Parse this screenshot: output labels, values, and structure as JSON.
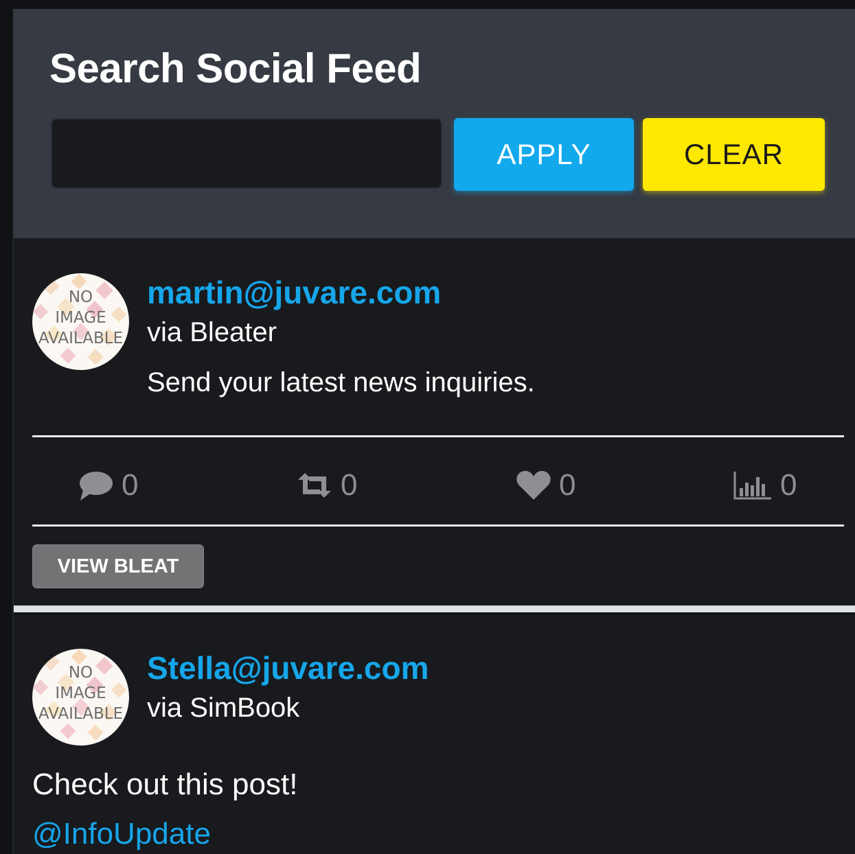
{
  "search": {
    "title": "Search Social Feed",
    "input_value": "",
    "input_placeholder": "",
    "apply_label": "APPLY",
    "clear_label": "CLEAR"
  },
  "colors": {
    "accent_blue": "#16a6ea",
    "apply_button": "#12a8ec",
    "clear_button": "#ffe800",
    "header_bg": "#363a42",
    "panel_bg": "#181a1d"
  },
  "avatar": {
    "line1": "NO",
    "line2": "IMAGE",
    "line3": "AVAILABLE"
  },
  "posts": [
    {
      "author": "martin@juvare.com",
      "source": "via Bleater",
      "text": "Send your latest news inquiries.",
      "stats": {
        "comments": "0",
        "reposts": "0",
        "likes": "0",
        "views": "0"
      },
      "view_label": "VIEW BLEAT",
      "icons": [
        "comment-icon",
        "repost-icon",
        "heart-icon",
        "bar-chart-icon"
      ]
    },
    {
      "author": "Stella@juvare.com",
      "source": "via SimBook",
      "text": "Check out this post!",
      "mention": "@InfoUpdate"
    }
  ]
}
